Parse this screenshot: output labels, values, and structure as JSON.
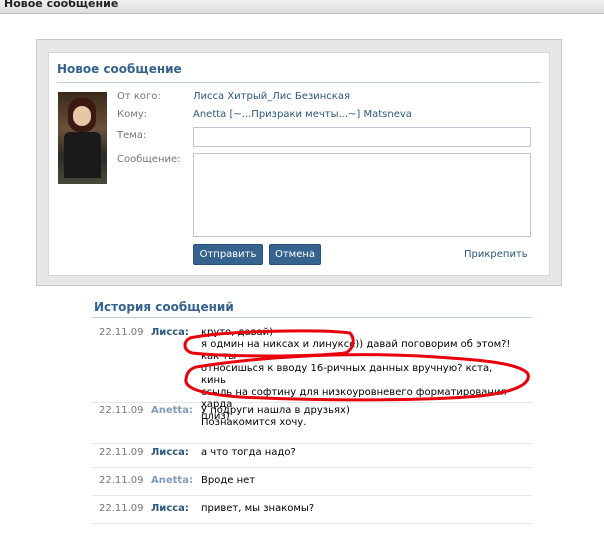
{
  "window": {
    "title": "Новое сообщение"
  },
  "form": {
    "heading": "Новое сообщение",
    "from_label": "От кого:",
    "from_value": "Лисса Хитрый_Лис Безинская",
    "to_label": "Кому:",
    "to_value": "Anetta [~...Призраки мечты...~] Matsneva",
    "subject_label": "Тема:",
    "subject_value": "",
    "message_label": "Сообщение:",
    "message_value": "",
    "send_label": "Отправить",
    "cancel_label": "Отмена",
    "attach_label": "Прикрепить"
  },
  "history": {
    "title": "История сообщений",
    "messages": [
      {
        "date": "22.11.09",
        "author": "Лисса:",
        "text": "круто, давай)\nя одмин на никсах и линуксе)) давай поговорим об этом?! как ты\nотносишься к вводу 16-ричных данных вручную? кста, кинь\nссыль на софтину для низкоуровневего форматирования харда\nплиз)"
      },
      {
        "date": "22.11.09",
        "author": "Anetta:",
        "text": "У подруги нашла в друзьях)\nПознакомится хочу."
      },
      {
        "date": "22.11.09",
        "author": "Лисса:",
        "text": "а что тогда надо?"
      },
      {
        "date": "22.11.09",
        "author": "Anetta:",
        "text": "Вроде нет"
      },
      {
        "date": "22.11.09",
        "author": "Лисса:",
        "text": "привет, мы знакомы?"
      }
    ]
  },
  "colors": {
    "accent": "#36638e",
    "author_self": "#2b587a",
    "author_other": "#7f9db9",
    "annotation": "#e8000c"
  }
}
